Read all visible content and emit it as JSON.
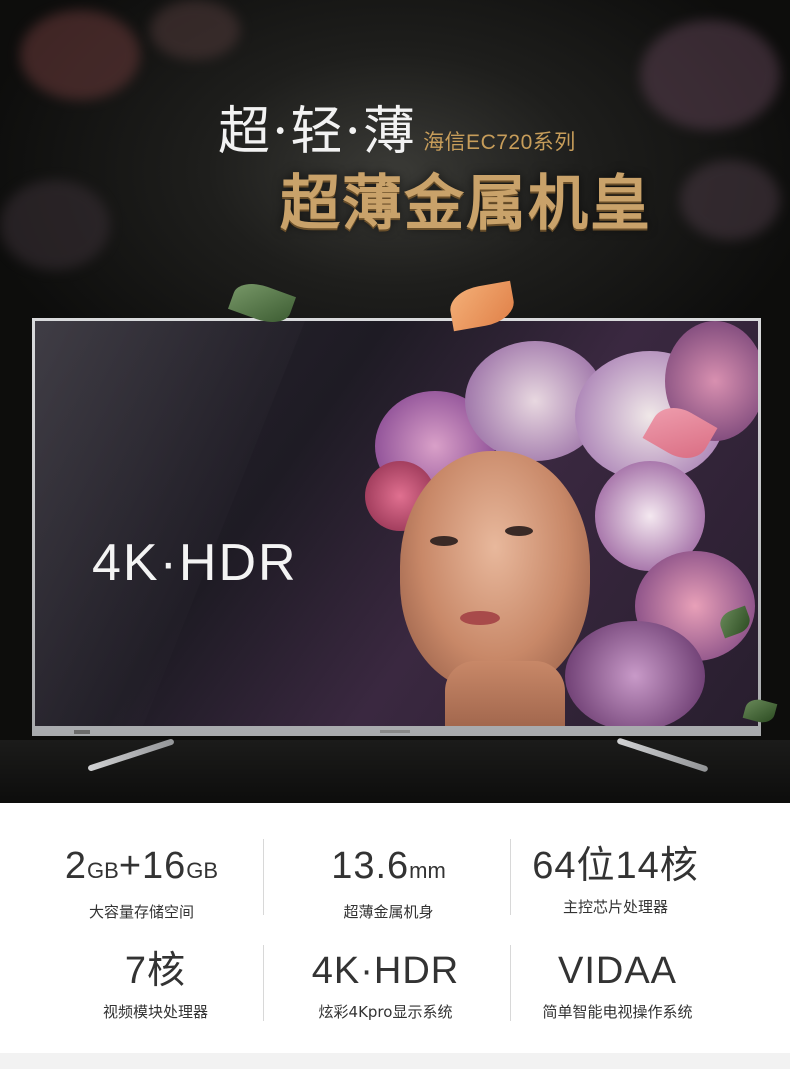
{
  "headline": {
    "main": "超·轻·薄",
    "series": "海信EC720系列",
    "sub": "超薄金属机皇"
  },
  "tv": {
    "screen_label": "4K·HDR"
  },
  "specs": [
    {
      "value": "2",
      "unit1": "GB",
      "mid": "+16",
      "unit2": "GB",
      "desc": "大容量存储空间"
    },
    {
      "value": "13.6",
      "unit": "mm",
      "desc": "超薄金属机身"
    },
    {
      "value": "64位14核",
      "desc": "主控芯片处理器"
    },
    {
      "value": "7核",
      "desc": "视频模块处理器"
    },
    {
      "value": "4K·HDR",
      "desc": "炫彩4Kpro显示系统"
    },
    {
      "value": "VIDAA",
      "desc": "简单智能电视操作系统"
    }
  ],
  "colors": {
    "gold": "#c9a26a",
    "series_gold": "#c79d5a",
    "text_dark": "#333333"
  }
}
